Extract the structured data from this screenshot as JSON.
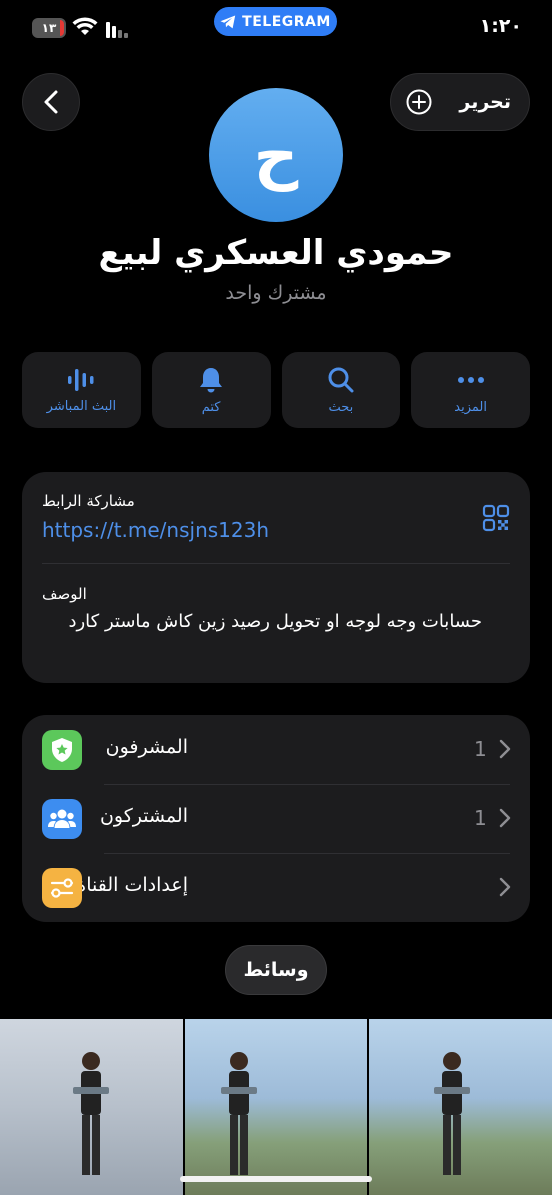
{
  "status_bar": {
    "battery": "١٣",
    "app_badge": "TELEGRAM",
    "time": "١:٢٠"
  },
  "header": {
    "edit_label": "تحرير"
  },
  "profile": {
    "avatar_letter": "ح",
    "channel_name": "حمودي العسكري لبيع",
    "subscribers": "مشترك واحد"
  },
  "actions": [
    {
      "label": "البث المباشر",
      "icon": "live-stream-icon"
    },
    {
      "label": "كتم",
      "icon": "bell-icon"
    },
    {
      "label": "بحث",
      "icon": "search-icon"
    },
    {
      "label": "المزيد",
      "icon": "more-icon"
    }
  ],
  "info": {
    "link_label": "مشاركة الرابط",
    "link": "https://t.me/nsjns123h",
    "description_label": "الوصف",
    "description": "حسابات وجه لوجه او تحويل رصيد زين كاش ماستر كارد"
  },
  "list": [
    {
      "title": "المشرفون",
      "count": "1",
      "icon": "admin-shield-icon",
      "color": "#5cc85b"
    },
    {
      "title": "المشتركون",
      "count": "1",
      "icon": "subscribers-icon",
      "color": "#3d8df0"
    },
    {
      "title": "إعدادات القناة",
      "count": "",
      "icon": "settings-sliders-icon",
      "color": "#f5b342"
    }
  ],
  "media": {
    "label": "وسائط"
  },
  "colors": {
    "accent": "#4e8fe8",
    "card": "#1c1c1e",
    "background": "#000000"
  }
}
